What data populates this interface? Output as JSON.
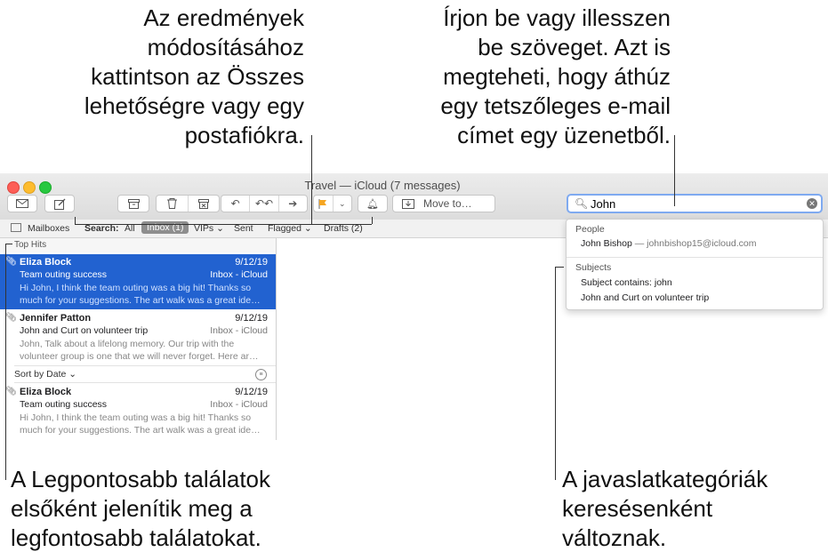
{
  "callouts": {
    "top_left": "Az eredmények\nmódosításához\nkattintson az Összes\nlehetőségre vagy egy\npostafiókra.",
    "top_right": "Írjon be vagy illesszen\nbe szöveget. Azt is\nmegteheti, hogy áthúz\negy tetszőleges e-mail\ncímet egy üzenetből.",
    "bottom_left": "A Legpontosabb találatok\nelsőként jelenítik meg a\nlegfontosabb találatokat.",
    "bottom_right": "A javaslatkategóriák\nkeresésenként\nváltoznak."
  },
  "window": {
    "title": "Travel — iCloud (7 messages)",
    "toolbar": {
      "move_to": "Move to…"
    },
    "search": {
      "value": "John"
    },
    "scope": {
      "mailboxes": "Mailboxes",
      "search_label": "Search:",
      "all": "All",
      "inbox": "Inbox (1)",
      "vips": "VIPs",
      "sent": "Sent",
      "flagged": "Flagged",
      "drafts": "Drafts (2)"
    },
    "top_hits_label": "Top Hits",
    "sort_label": "Sort by Date",
    "messages": [
      {
        "from": "Eliza Block",
        "date": "9/12/19",
        "subject": "Team outing success",
        "mailbox": "Inbox - iCloud",
        "preview": "Hi John, I think the team outing was a big hit! Thanks so much for your suggestions. The art walk was a great ide…"
      },
      {
        "from": "Jennifer Patton",
        "date": "9/12/19",
        "subject": "John and Curt on volunteer trip",
        "mailbox": "Inbox - iCloud",
        "preview": "John, Talk about a lifelong memory. Our trip with the volunteer group is one that we will never forget. Here ar…"
      },
      {
        "from": "Eliza Block",
        "date": "9/12/19",
        "subject": "Team outing success",
        "mailbox": "Inbox - iCloud",
        "preview": "Hi John, I think the team outing was a big hit! Thanks so much for your suggestions. The art walk was a great ide…"
      }
    ],
    "suggestions": {
      "people_label": "People",
      "person_name": "John Bishop",
      "person_email": "— johnbishop15@icloud.com",
      "subjects_label": "Subjects",
      "subject_1": "Subject contains: john",
      "subject_2": "John and Curt on volunteer trip"
    }
  },
  "colors": {
    "selection": "#2262d0",
    "search_focus": "#7faaf0",
    "flag": "#f5a623"
  }
}
